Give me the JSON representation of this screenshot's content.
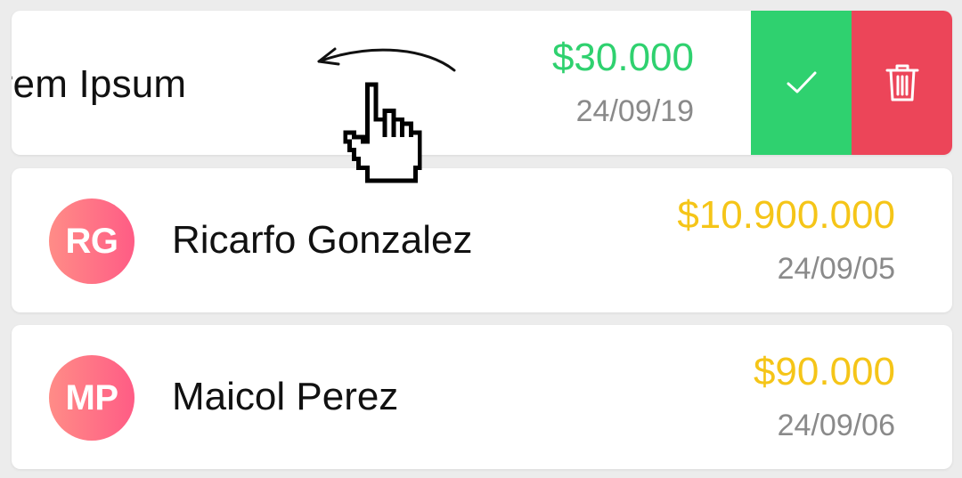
{
  "colors": {
    "amount_green": "#2fd16f",
    "amount_yellow": "#f5c518",
    "approve": "#2fd16f",
    "delete": "#ec4559",
    "avatar_gradient_start": "#ff8c87",
    "avatar_gradient_end": "#ff5c85"
  },
  "swiped_item": {
    "name": "orem Ipsum",
    "amount": "$30.000",
    "amount_color": "#2fd16f",
    "date": "24/09/19",
    "actions": {
      "approve_icon": "check-icon",
      "delete_icon": "trash-icon"
    }
  },
  "items": [
    {
      "initials": "RG",
      "name": "Ricarfo Gonzalez",
      "amount": "$10.900.000",
      "amount_color": "#f5c518",
      "date": "24/09/05"
    },
    {
      "initials": "MP",
      "name": "Maicol Perez",
      "amount": "$90.000",
      "amount_color": "#f5c518",
      "date": "24/09/06"
    }
  ],
  "gesture": {
    "arrow_icon": "swipe-left-arrow-icon",
    "cursor_icon": "hand-pointer-icon"
  }
}
